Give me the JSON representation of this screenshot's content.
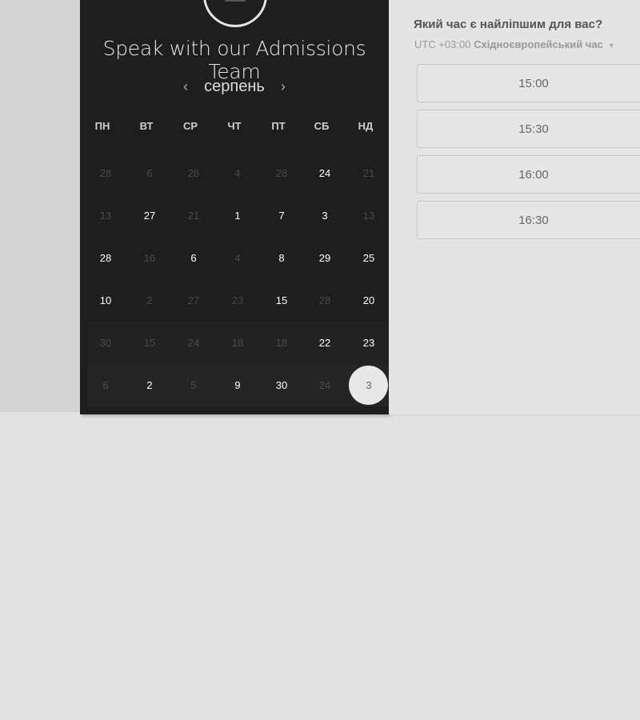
{
  "calendar": {
    "title": "Speak with our Admissions Team",
    "month": "серпень",
    "prev_icon": "chevron-left-icon",
    "next_icon": "chevron-right-icon",
    "weekdays": [
      "ПН",
      "ВТ",
      "СР",
      "ЧТ",
      "ПТ",
      "СБ",
      "НД"
    ],
    "weeks": [
      [
        "28",
        "6",
        "28",
        "4",
        "28",
        "24",
        "21"
      ],
      [
        "13",
        "27",
        "21",
        "1",
        "7",
        "3",
        "13"
      ],
      [
        "28",
        "16",
        "6",
        "4",
        "8",
        "29",
        "25"
      ],
      [
        "10",
        "2",
        "27",
        "23",
        "15",
        "28",
        "20"
      ],
      [
        "30",
        "15",
        "24",
        "18",
        "18",
        "22",
        "23"
      ],
      [
        "6",
        "2",
        "5",
        "9",
        "30",
        "24",
        "3"
      ]
    ],
    "available": [
      [
        false,
        false,
        false,
        false,
        false,
        true,
        false
      ],
      [
        false,
        true,
        false,
        true,
        true,
        true,
        false
      ],
      [
        true,
        false,
        true,
        false,
        true,
        true,
        true
      ],
      [
        true,
        false,
        false,
        false,
        true,
        false,
        true
      ],
      [
        false,
        false,
        false,
        false,
        false,
        true,
        true
      ],
      [
        false,
        true,
        false,
        true,
        true,
        false,
        false
      ]
    ],
    "selected": {
      "week": 5,
      "day": 6
    }
  },
  "times": {
    "question": "Який час є найліпшим для вас?",
    "timezone_offset": "UTC +03:00",
    "timezone_name": "Східноєвропейський час",
    "slots": [
      "15:00",
      "15:30",
      "16:00",
      "16:30"
    ]
  },
  "colors": {
    "panel_bg": "#1e1e1e",
    "page_bg": "#e2e2e2",
    "selected_day_bg": "#e8e8e8"
  }
}
